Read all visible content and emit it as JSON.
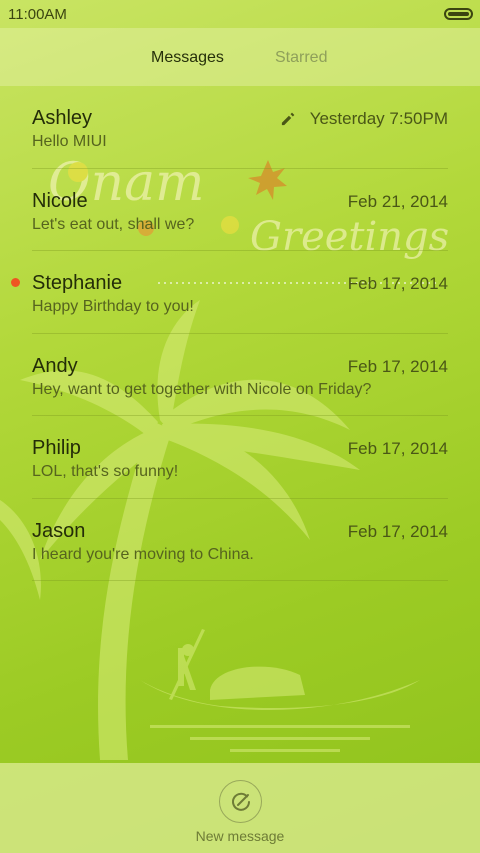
{
  "status_bar": {
    "time": "11:00AM",
    "battery_icon": "battery-icon"
  },
  "tabs": [
    {
      "label": "Messages",
      "active": true
    },
    {
      "label": "Starred",
      "active": false
    }
  ],
  "conversations": [
    {
      "name": "Ashley",
      "time": "Yesterday 7:50PM",
      "snippet": "Hello MIUI",
      "draft": true,
      "unread": false
    },
    {
      "name": "Nicole",
      "time": "Feb 21, 2014",
      "snippet": "Let's eat out, shall we?",
      "draft": false,
      "unread": false
    },
    {
      "name": "Stephanie",
      "time": "Feb 17, 2014",
      "snippet": "Happy Birthday to you!",
      "draft": false,
      "unread": true
    },
    {
      "name": "Andy",
      "time": "Feb 17, 2014",
      "snippet": "Hey, want to get together with Nicole on Friday?",
      "draft": false,
      "unread": false
    },
    {
      "name": "Philip",
      "time": "Feb 17, 2014",
      "snippet": "LOL, that's so funny!",
      "draft": false,
      "unread": false
    },
    {
      "name": "Jason",
      "time": "Feb 17, 2014",
      "snippet": "I heard you're moving to China.",
      "draft": false,
      "unread": false
    }
  ],
  "wallpaper": {
    "line1": "Onam",
    "line2": "Greetings"
  },
  "compose": {
    "label": "New message",
    "icon": "compose-icon"
  },
  "colors": {
    "accent_unread": "#ee5522",
    "background_top": "#c9e463",
    "background_bottom": "#8fc21c"
  }
}
